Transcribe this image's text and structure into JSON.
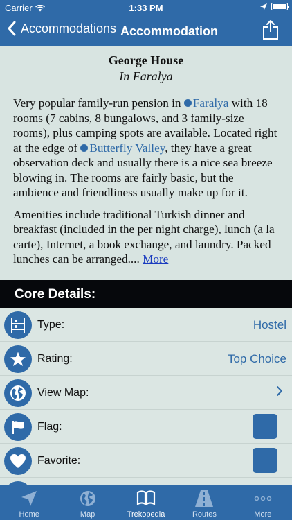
{
  "status": {
    "carrier": "Carrier",
    "time": "1:33 PM"
  },
  "nav": {
    "back_label": "Accommodations",
    "title": "Accommodation"
  },
  "place": {
    "name": "George House",
    "location": "In Faralya",
    "para1": {
      "t1": "Very popular family-run pension in ",
      "link1": "Faralya",
      "t2": " with 18 rooms (7 cabins, 8 bungalows, and 3 family-size rooms), plus camping spots are available. Located right at the edge of ",
      "link2": "Butterfly Valley",
      "t3": ", they have a great observation deck and usually there is a nice sea breeze blowing in. The rooms are fairly basic, but the ambience and friendliness usually make up for it."
    },
    "para2": {
      "text": "Amenities include traditional Turkish dinner and breakfast (included in the per night charge), lunch (a la carte), Internet, a book exchange, and laundry. Packed lunches can be arranged.... ",
      "more": "More"
    }
  },
  "core": {
    "header": "Core Details:",
    "rows": [
      {
        "label": "Type:",
        "value": "Hostel",
        "icon": "bunk-bed-icon"
      },
      {
        "label": "Rating:",
        "value": "Top Choice",
        "icon": "star-icon"
      },
      {
        "label": "View Map:",
        "value": "",
        "icon": "globe-icon"
      },
      {
        "label": "Flag:",
        "value": "",
        "icon": "flag-icon"
      },
      {
        "label": "Favorite:",
        "value": "",
        "icon": "heart-icon"
      }
    ]
  },
  "tabs": [
    {
      "label": "Home",
      "icon": "navigation-arrow-icon"
    },
    {
      "label": "Map",
      "icon": "globe-icon"
    },
    {
      "label": "Trekopedia",
      "icon": "book-icon"
    },
    {
      "label": "Routes",
      "icon": "road-icon"
    },
    {
      "label": "More",
      "icon": "more-dots-icon"
    }
  ],
  "colors": {
    "brand": "#2f6aa8",
    "background": "#dde7e4",
    "header": "#06080c"
  }
}
